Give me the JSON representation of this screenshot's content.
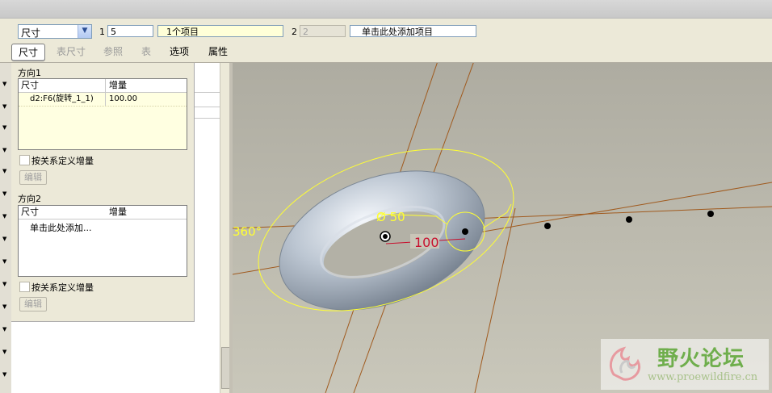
{
  "toolbar": {
    "type_select": "尺寸",
    "collector1_label": "1",
    "collector1_value": "5",
    "collector1_items": "1个项目",
    "collector2_label": "2",
    "collector2_value": "2",
    "collector2_placeholder": "单击此处添加项目"
  },
  "tabs": [
    {
      "label": "尺寸",
      "state": "active"
    },
    {
      "label": "表尺寸",
      "state": "disabled"
    },
    {
      "label": "参照",
      "state": "disabled"
    },
    {
      "label": "表",
      "state": "disabled"
    },
    {
      "label": "选项",
      "state": "enabled"
    },
    {
      "label": "属性",
      "state": "enabled"
    }
  ],
  "direction1": {
    "title": "方向1",
    "col_dim": "尺寸",
    "col_inc": "增量",
    "row_dim": "d2:F6(旋转_1_1)",
    "row_inc": "100.00",
    "relation_label": "按关系定义增量",
    "edit_label": "编辑"
  },
  "direction2": {
    "title": "方向2",
    "col_dim": "尺寸",
    "col_inc": "增量",
    "add_hint": "单击此处添加...",
    "relation_label": "按关系定义增量",
    "edit_label": "编辑"
  },
  "viewport": {
    "angle_label": "360°",
    "diameter_label": "Ø 50",
    "spacing_label": "100",
    "pattern_points": 5
  },
  "watermark": {
    "title": "野火论坛",
    "url": "www.proewildfire.cn"
  },
  "colors": {
    "sketch_yellow": "#ffff33",
    "axis_brown": "#a05a1e",
    "dim_red": "#c8102e",
    "torus": "#b8c3cf"
  }
}
